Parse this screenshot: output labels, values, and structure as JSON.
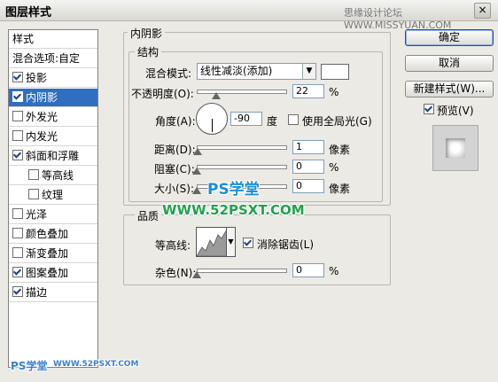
{
  "window": {
    "title": "图层样式",
    "watermark_top": "思缘设计论坛 WWW.MISSYUAN.COM",
    "close_label": "×"
  },
  "sidebar": {
    "items": [
      {
        "label": "样式",
        "checkbox": false,
        "checked": false,
        "selected": false,
        "indent": false
      },
      {
        "label": "混合选项:自定",
        "checkbox": false,
        "checked": false,
        "selected": false,
        "indent": false
      },
      {
        "label": "投影",
        "checkbox": true,
        "checked": true,
        "selected": false,
        "indent": false
      },
      {
        "label": "内阴影",
        "checkbox": true,
        "checked": true,
        "selected": true,
        "indent": false
      },
      {
        "label": "外发光",
        "checkbox": true,
        "checked": false,
        "selected": false,
        "indent": false
      },
      {
        "label": "内发光",
        "checkbox": true,
        "checked": false,
        "selected": false,
        "indent": false
      },
      {
        "label": "斜面和浮雕",
        "checkbox": true,
        "checked": true,
        "selected": false,
        "indent": false
      },
      {
        "label": "等高线",
        "checkbox": true,
        "checked": false,
        "selected": false,
        "indent": true
      },
      {
        "label": "纹理",
        "checkbox": true,
        "checked": false,
        "selected": false,
        "indent": true
      },
      {
        "label": "光泽",
        "checkbox": true,
        "checked": false,
        "selected": false,
        "indent": false
      },
      {
        "label": "颜色叠加",
        "checkbox": true,
        "checked": false,
        "selected": false,
        "indent": false
      },
      {
        "label": "渐变叠加",
        "checkbox": true,
        "checked": false,
        "selected": false,
        "indent": false
      },
      {
        "label": "图案叠加",
        "checkbox": true,
        "checked": true,
        "selected": false,
        "indent": false
      },
      {
        "label": "描边",
        "checkbox": true,
        "checked": true,
        "selected": false,
        "indent": false
      }
    ]
  },
  "main": {
    "section_title": "内阴影",
    "structure": {
      "title": "结构",
      "blend_mode_label": "混合模式:",
      "blend_mode_value": "线性减淡(添加)",
      "opacity_label": "不透明度(O):",
      "opacity_value": "22",
      "opacity_unit": "%",
      "angle_label": "角度(A):",
      "angle_value": "-90",
      "angle_unit": "度",
      "global_light_label": "使用全局光(G)",
      "global_light_checked": false,
      "distance_label": "距离(D):",
      "distance_value": "1",
      "distance_unit": "像素",
      "choke_label": "阻塞(C):",
      "choke_value": "0",
      "choke_unit": "%",
      "size_label": "大小(S):",
      "size_value": "0",
      "size_unit": "像素"
    },
    "quality": {
      "title": "品质",
      "contour_label": "等高线:",
      "antialias_label": "消除锯齿(L)",
      "antialias_checked": true,
      "noise_label": "杂色(N):",
      "noise_value": "0",
      "noise_unit": "%"
    }
  },
  "actions": {
    "ok_label": "确定",
    "cancel_label": "取消",
    "new_style_label": "新建样式(W)...",
    "preview_label": "预览(V)",
    "preview_checked": true
  },
  "watermarks": {
    "ps_text": "PS学堂",
    "url_text": "WWW.52PSXT.COM",
    "footer_ps": "PS学堂",
    "footer_url": "WWW.52PSXT.COM"
  },
  "levels": {
    "opacity_fraction": 0.22,
    "distance_fraction": 0.01,
    "choke_fraction": 0.0,
    "size_fraction": 0.0,
    "noise_fraction": 0.0,
    "angle_degrees": -90
  },
  "colors": {
    "selected_row": "#2f6fbf",
    "watermark_blue": "#1a8fd4",
    "watermark_green": "#1fa34a"
  }
}
